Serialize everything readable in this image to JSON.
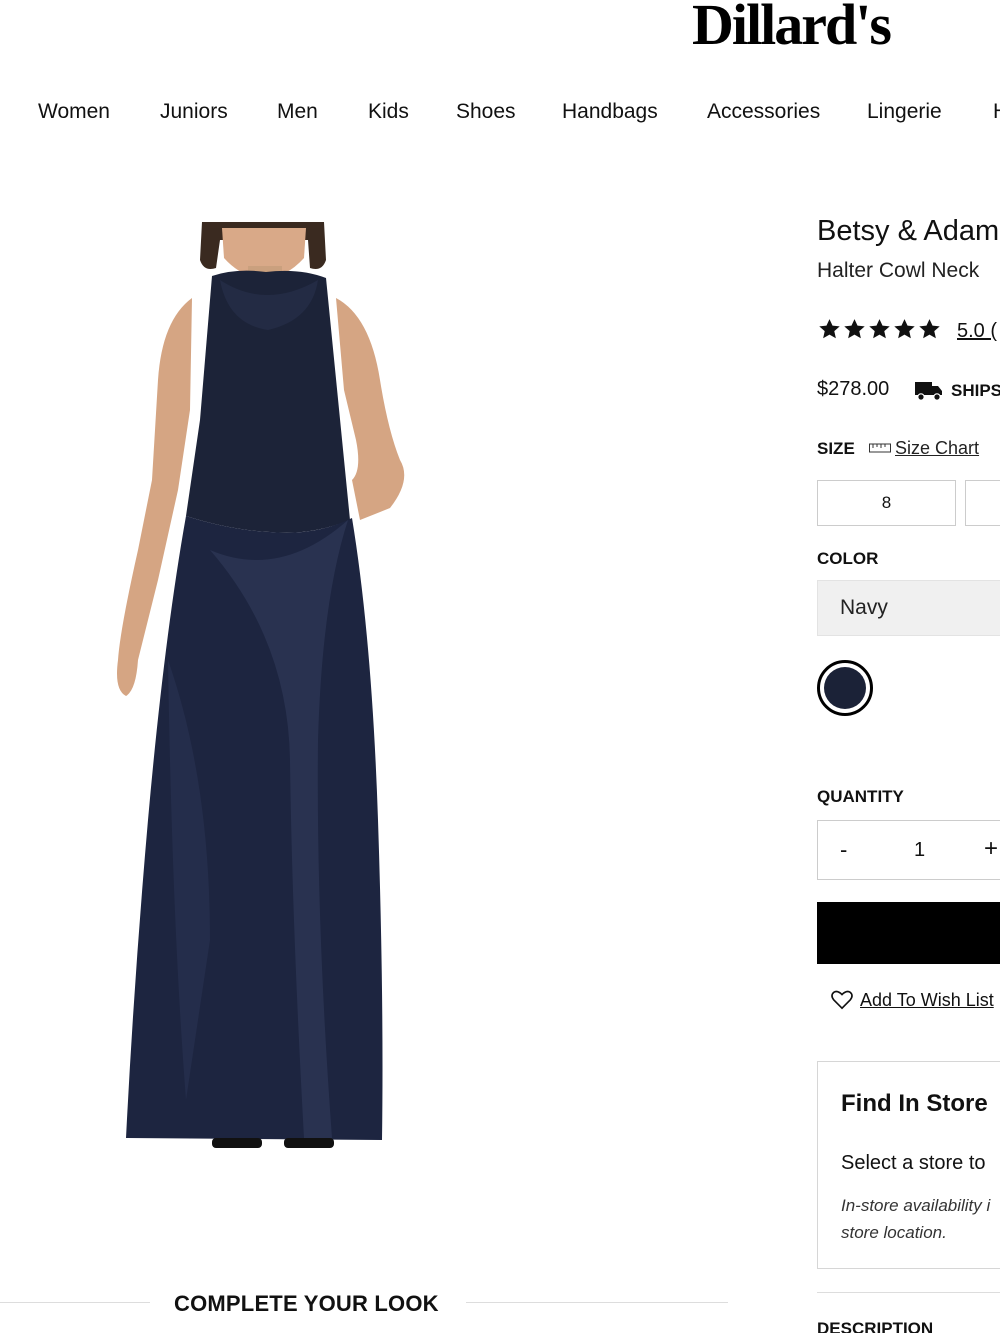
{
  "header": {
    "logo": "Dillard's"
  },
  "nav": {
    "items": [
      "Women",
      "Juniors",
      "Men",
      "Kids",
      "Shoes",
      "Handbags",
      "Accessories",
      "Lingerie",
      "H"
    ]
  },
  "product": {
    "brand": "Betsy & Adam",
    "name": "Halter Cowl Neck",
    "rating": "5.0 (",
    "rating_stars": 5,
    "price": "$278.00",
    "ships_label": "SHIPS",
    "size_label": "SIZE",
    "size_chart_label": "Size Chart",
    "sizes": [
      "8",
      ""
    ],
    "color_label": "COLOR",
    "selected_color": "Navy",
    "swatch_color": "#1b2237",
    "quantity_label": "QUANTITY",
    "qty_minus": "-",
    "quantity": "1",
    "qty_plus": "+",
    "wish_list_label": "Add To Wish List"
  },
  "find_in_store": {
    "title": "Find In Store",
    "text": "Select a store to",
    "note_line1": "In-store availability i",
    "note_line2": "store location."
  },
  "description_label": "DESCRIPTION",
  "complete_look": "COMPLETE YOUR LOOK",
  "colors": {
    "navy": "#1c2338",
    "dress_highlight": "#2c3553",
    "skin": "#d9a988",
    "hair": "#3a2a20",
    "button": "#000000"
  }
}
